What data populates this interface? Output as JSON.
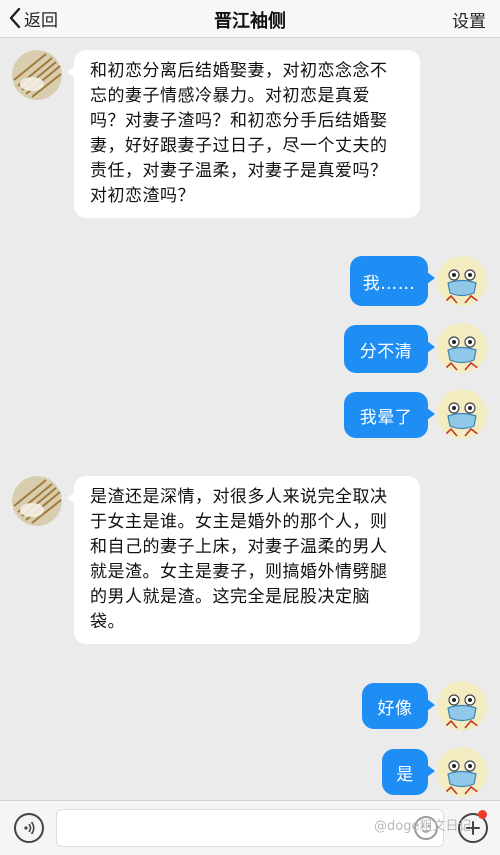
{
  "header": {
    "back_label": "返回",
    "title": "晋江袖侧",
    "settings_label": "设置"
  },
  "messages": [
    {
      "direction": "in",
      "text": "和初恋分离后结婚娶妻，对初恋念念不忘的妻子情感冷暴力。对初恋是真爱吗？对妻子渣吗？和初恋分手后结婚娶妻，好好跟妻子过日子，尽一个丈夫的责任，对妻子温柔，对妻子是真爱吗？对初恋渣吗？"
    },
    {
      "direction": "out",
      "text": "我……"
    },
    {
      "direction": "out",
      "text": "分不清"
    },
    {
      "direction": "out",
      "text": "我晕了"
    },
    {
      "direction": "in",
      "text": "是渣还是深情，对很多人来说完全取决于女主是谁。女主是婚外的那个人，则和自己的妻子上床，对妻子温柔的男人就是渣。女主是妻子，则搞婚外情劈腿的男人就是渣。这完全是屁股决定脑袋。"
    },
    {
      "direction": "out",
      "text": "好像"
    },
    {
      "direction": "out",
      "text": "是"
    }
  ],
  "footer": {
    "watermark": "@doge粗文日记"
  },
  "colors": {
    "accent": "#1e8ef5",
    "background": "#ebebeb",
    "badge": "#f03a2a"
  }
}
